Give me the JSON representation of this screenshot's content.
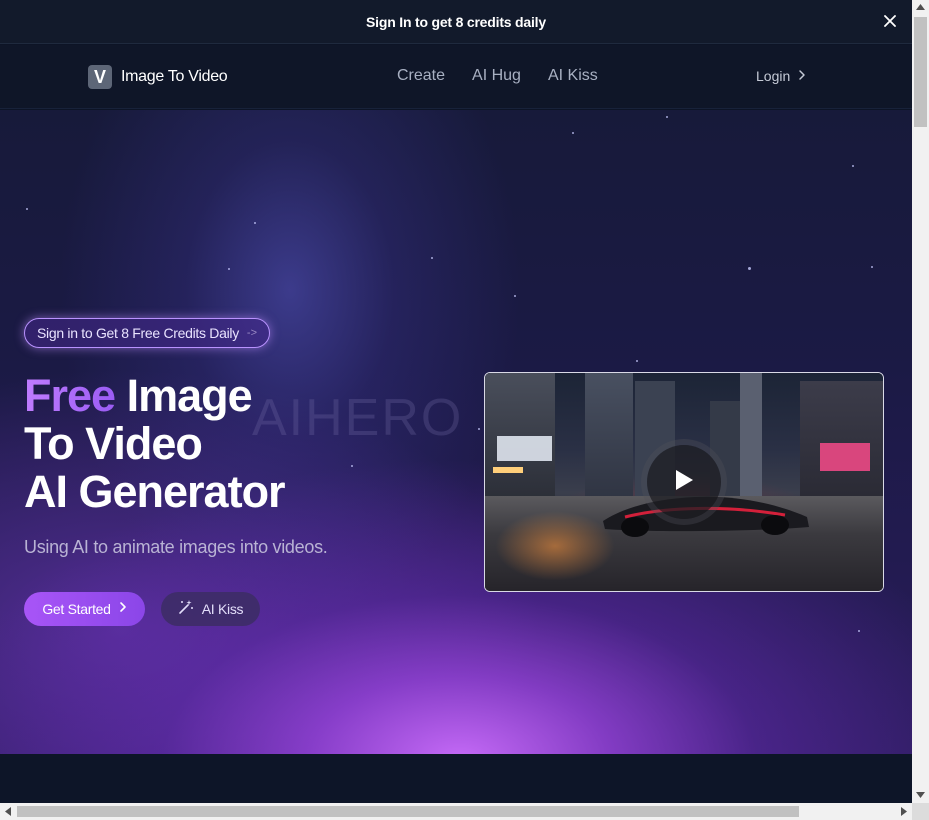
{
  "banner": {
    "text": "Sign In to get 8 credits daily",
    "close_icon": "close-icon"
  },
  "nav": {
    "brand_logo_letter": "V",
    "brand_name": "Image To Video",
    "links": [
      "Create",
      "AI Hug",
      "AI Kiss"
    ],
    "login_label": "Login"
  },
  "hero": {
    "signin_pill": "Sign in to Get 8 Free Credits Daily",
    "signin_pill_arrow": "->",
    "headline_accent": "Free",
    "headline_line1_rest": "Image",
    "headline_line2": "To Video",
    "headline_line3": "AI Generator",
    "watermark": "AIHERO",
    "subtitle": "Using AI to animate images into videos.",
    "primary_button": "Get Started",
    "secondary_button": "AI Kiss",
    "video_play_icon": "play-icon"
  },
  "colors": {
    "accent": "#a855f7",
    "banner_bg": "#121a2b",
    "nav_bg": "#0f1628"
  }
}
